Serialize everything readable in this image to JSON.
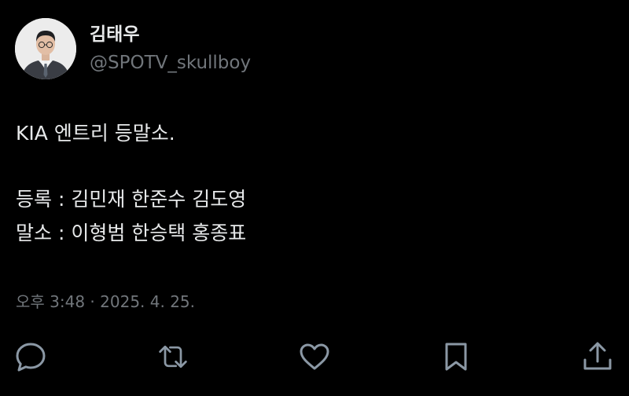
{
  "author": {
    "display_name": "김태우",
    "handle": "@SPOTV_skullboy"
  },
  "tweet": {
    "line1": "KIA 엔트리 등말소.",
    "line2": "등록 : 김민재 한준수 김도영",
    "line3": "말소 : 이형범 한승택 홍종표",
    "timestamp": "오후 3:48 · 2025. 4. 25."
  },
  "actions": {
    "reply_icon": "reply-icon",
    "retweet_icon": "retweet-icon",
    "like_icon": "heart-icon",
    "bookmark_icon": "bookmark-icon",
    "share_icon": "share-icon"
  },
  "colors": {
    "background": "#000000",
    "primary_text": "#e7e9ea",
    "secondary_text": "#71767b",
    "icon": "#8b98a5"
  }
}
